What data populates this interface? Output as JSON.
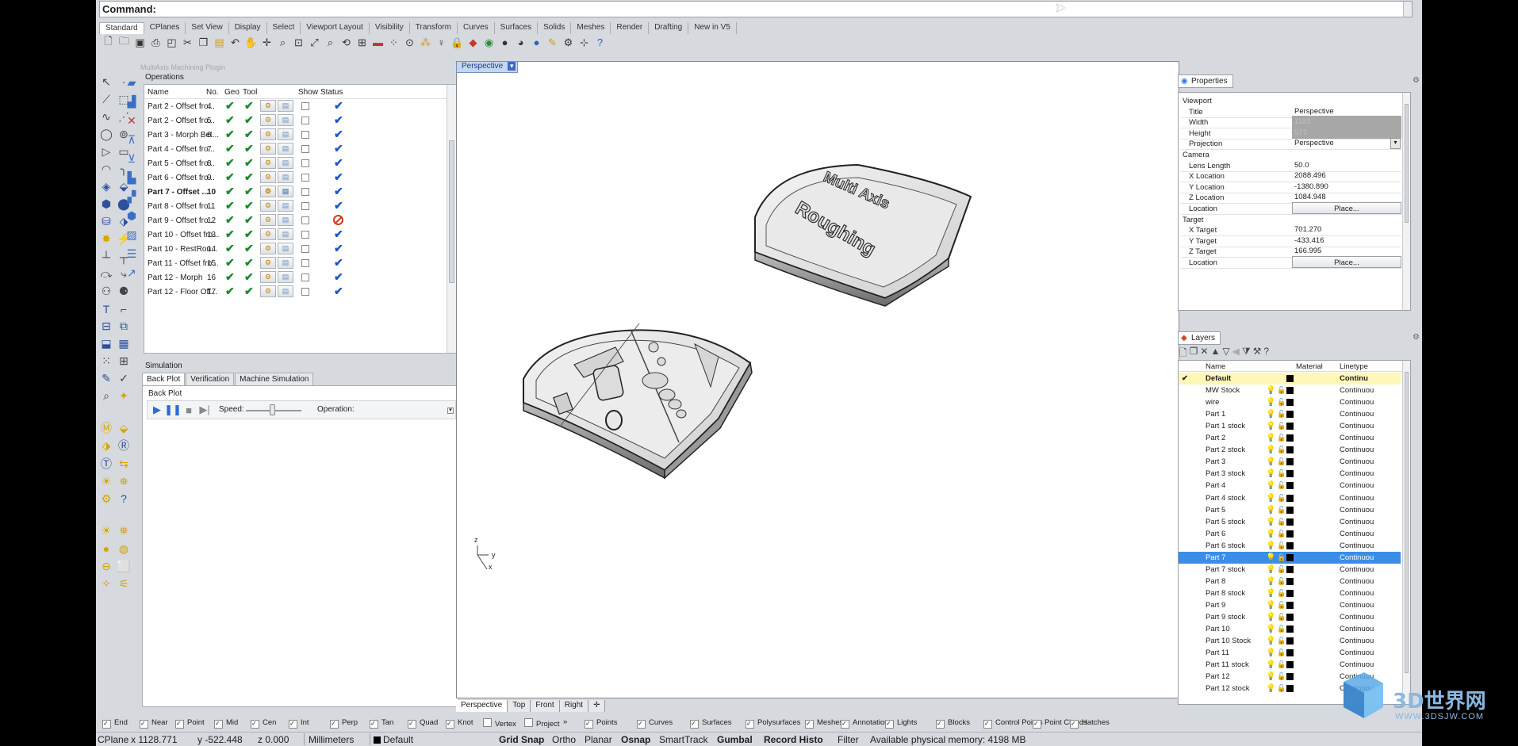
{
  "command": {
    "label": "Command:"
  },
  "toolbar_tabs": [
    "Standard",
    "CPlanes",
    "Set View",
    "Display",
    "Select",
    "Viewport Layout",
    "Visibility",
    "Transform",
    "Curves",
    "Surfaces",
    "Solids",
    "Meshes",
    "Render",
    "Drafting",
    "New in V5"
  ],
  "plugin": {
    "title": "MultiAxis Machining Plugin",
    "operations_label": "Operations",
    "columns": [
      "Name",
      "No.",
      "Geo",
      "Tool",
      "Show",
      "Status"
    ],
    "rows": [
      {
        "name": "Part 2 - Offset fro...",
        "no": "4",
        "status": "ok"
      },
      {
        "name": "Part 2 - Offset fro...",
        "no": "5",
        "status": "ok"
      },
      {
        "name": "Part 3 - Morph Bet...",
        "no": "6",
        "status": "ok"
      },
      {
        "name": "Part 4 - Offset fro...",
        "no": "7",
        "status": "ok"
      },
      {
        "name": "Part 5 - Offset fro...",
        "no": "8",
        "status": "ok"
      },
      {
        "name": "Part 6 - Offset fro...",
        "no": "9",
        "status": "ok"
      },
      {
        "name": "Part 7 - Offset ...",
        "no": "10",
        "status": "ok",
        "bold": true
      },
      {
        "name": "Part 8 - Offset fro...",
        "no": "11",
        "status": "ok"
      },
      {
        "name": "Part 9 - Offset fro...",
        "no": "12",
        "status": "error"
      },
      {
        "name": "Part 10 - Offset fro...",
        "no": "13",
        "status": "ok"
      },
      {
        "name": "Part 10 - RestRou...",
        "no": "14",
        "status": "ok"
      },
      {
        "name": "Part 11 - Offset fro...",
        "no": "15",
        "status": "ok"
      },
      {
        "name": "Part 12 - Morph",
        "no": "16",
        "status": "ok"
      },
      {
        "name": "Part 12 - Floor Off...",
        "no": "17",
        "status": "ok"
      }
    ],
    "simulation_label": "Simulation",
    "sim_tabs": [
      "Back Plot",
      "Verification",
      "Machine Simulation"
    ],
    "backplot_label": "Back Plot",
    "speed_label": "Speed:",
    "operation_label": "Operation:"
  },
  "viewport": {
    "tab_label": "Perspective",
    "bottom_tabs": [
      "Perspective",
      "Top",
      "Front",
      "Right"
    ],
    "model_text_1": "Multi Axis",
    "model_text_2": "Roughing",
    "axis_labels": {
      "z": "z",
      "y": "y",
      "x": "x"
    }
  },
  "properties": {
    "tab_label": "Properties",
    "rows": [
      {
        "type": "section",
        "key": "Viewport"
      },
      {
        "key": "Title",
        "value": "Perspective"
      },
      {
        "key": "Width",
        "value": "1183",
        "disabled": true
      },
      {
        "key": "Height",
        "value": "577",
        "disabled": true
      },
      {
        "key": "Projection",
        "value": "Perspective",
        "dropdown": true
      },
      {
        "type": "section",
        "key": "Camera"
      },
      {
        "key": "Lens Length",
        "value": "50.0"
      },
      {
        "key": "X Location",
        "value": "2088.496"
      },
      {
        "key": "Y Location",
        "value": "-1380.890"
      },
      {
        "key": "Z Location",
        "value": "1084.948"
      },
      {
        "key": "Location",
        "value": "Place...",
        "button": true
      },
      {
        "type": "section",
        "key": "Target"
      },
      {
        "key": "X Target",
        "value": "701.270"
      },
      {
        "key": "Y Target",
        "value": "-433.416"
      },
      {
        "key": "Z Target",
        "value": "166.995"
      },
      {
        "key": "Location",
        "value": "Place...",
        "button": true
      }
    ]
  },
  "layers": {
    "tab_label": "Layers",
    "columns": [
      "Name",
      "Material",
      "Linetype"
    ],
    "rows": [
      {
        "name": "Default",
        "linetype": "Continu",
        "current": true
      },
      {
        "name": "MW Stock",
        "linetype": "Continuou"
      },
      {
        "name": "wire",
        "linetype": "Continuou"
      },
      {
        "name": "Part 1",
        "linetype": "Continuou"
      },
      {
        "name": "Part 1 stock",
        "linetype": "Continuou"
      },
      {
        "name": "Part 2",
        "linetype": "Continuou"
      },
      {
        "name": "Part 2 stock",
        "linetype": "Continuou"
      },
      {
        "name": "Part 3",
        "linetype": "Continuou"
      },
      {
        "name": "Part 3 stock",
        "linetype": "Continuou"
      },
      {
        "name": "Part 4",
        "linetype": "Continuou"
      },
      {
        "name": "Part 4 stock",
        "linetype": "Continuou"
      },
      {
        "name": "Part 5",
        "linetype": "Continuou"
      },
      {
        "name": "Part 5 stock",
        "linetype": "Continuou"
      },
      {
        "name": "Part 6",
        "linetype": "Continuou"
      },
      {
        "name": "Part 6 stock",
        "linetype": "Continuou"
      },
      {
        "name": "Part 7",
        "linetype": "Continuou",
        "selected": true
      },
      {
        "name": "Part 7 stock",
        "linetype": "Continuou"
      },
      {
        "name": "Part 8",
        "linetype": "Continuou",
        "bulb_off": true
      },
      {
        "name": "Part 8 stock",
        "linetype": "Continuou"
      },
      {
        "name": "Part 9",
        "linetype": "Continuou"
      },
      {
        "name": "Part 9 stock",
        "linetype": "Continuou"
      },
      {
        "name": "Part 10",
        "linetype": "Continuou"
      },
      {
        "name": "Part 10 Stock",
        "linetype": "Continuou"
      },
      {
        "name": "Part 11",
        "linetype": "Continuou"
      },
      {
        "name": "Part 11 stock",
        "linetype": "Continuou"
      },
      {
        "name": "Part 12",
        "linetype": "Continuou"
      },
      {
        "name": "Part 12 stock",
        "linetype": "Continuou"
      }
    ]
  },
  "osnaps": [
    {
      "label": "End",
      "on": true
    },
    {
      "label": "Near",
      "on": true
    },
    {
      "label": "Point",
      "on": true
    },
    {
      "label": "Mid",
      "on": true
    },
    {
      "label": "Cen",
      "on": true
    },
    {
      "label": "Int",
      "on": true
    },
    {
      "label": "Perp",
      "on": true
    },
    {
      "label": "Tan",
      "on": true
    },
    {
      "label": "Quad",
      "on": true
    },
    {
      "label": "Knot",
      "on": true
    },
    {
      "label": "Vertex",
      "on": false
    },
    {
      "label": "Project",
      "on": false
    },
    {
      "label": "Points",
      "on": true
    },
    {
      "label": "Curves",
      "on": true
    },
    {
      "label": "Surfaces",
      "on": true
    },
    {
      "label": "Polysurfaces",
      "on": true
    },
    {
      "label": "Meshes",
      "on": true
    },
    {
      "label": "Annotations",
      "on": true
    },
    {
      "label": "Lights",
      "on": true
    },
    {
      "label": "Blocks",
      "on": true
    },
    {
      "label": "Control Points",
      "on": true
    },
    {
      "label": "Point Clouds",
      "on": true
    },
    {
      "label": "Hatches",
      "on": true
    }
  ],
  "status": {
    "cplane": "CPlane",
    "x": "x 1128.771",
    "y": "y -522.448",
    "z": "z 0.000",
    "units": "Millimeters",
    "layer": "Default",
    "grid_snap": "Grid Snap",
    "ortho": "Ortho",
    "planar": "Planar",
    "osnap": "Osnap",
    "smarttrack": "SmartTrack",
    "gumball": "Gumbal",
    "record_history": "Record Histo",
    "filter": "Filter",
    "memory": "Available physical memory: 4198 MB"
  },
  "watermark": {
    "brand": "3D世界网",
    "url": "WWW.3DSJW.COM"
  }
}
